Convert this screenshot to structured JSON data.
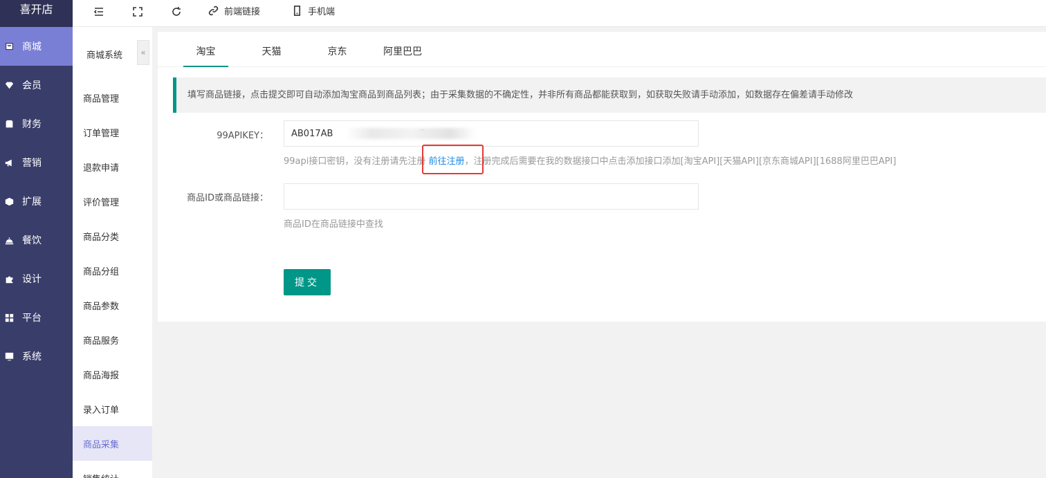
{
  "app": {
    "logo": "喜开店"
  },
  "sidebar": {
    "items": [
      {
        "label": "商城",
        "icon": "shop-icon",
        "active": true
      },
      {
        "label": "会员",
        "icon": "member-icon"
      },
      {
        "label": "财务",
        "icon": "finance-icon"
      },
      {
        "label": "营销",
        "icon": "megaphone-icon"
      },
      {
        "label": "扩展",
        "icon": "cube-icon"
      },
      {
        "label": "餐饮",
        "icon": "dish-icon"
      },
      {
        "label": "设计",
        "icon": "puzzle-icon"
      },
      {
        "label": "平台",
        "icon": "grid-icon"
      },
      {
        "label": "系统",
        "icon": "system-icon"
      }
    ]
  },
  "topbar": {
    "frontend_link": "前端链接",
    "mobile": "手机端"
  },
  "subnav": {
    "title": "商城系统",
    "collapse": "«",
    "items": [
      "商品管理",
      "订单管理",
      "退款申请",
      "评价管理",
      "商品分类",
      "商品分组",
      "商品参数",
      "商品服务",
      "商品海报",
      "录入订单",
      "商品采集",
      "销售统计"
    ],
    "active_index": 10
  },
  "tabs": [
    "淘宝",
    "天猫",
    "京东",
    "阿里巴巴"
  ],
  "notice": "填写商品链接，点击提交即可自动添加淘宝商品到商品列表；由于采集数据的不确定性，并非所有商品都能获取到，如获取失败请手动添加，如数据存在偏差请手动修改",
  "form": {
    "apikey_label": "99APIKEY：",
    "apikey_value": "AB017AB                              C",
    "apikey_help_before": "99api接口密钥，没有注册请先注册",
    "apikey_help_link": "前往注册",
    "apikey_help_after": "，注册完成后需要在我的数据接口中点击添加接口添加[淘宝API][天猫API][京东商城API][1688阿里巴巴API]",
    "goods_label": "商品ID或商品链接：",
    "goods_value": "",
    "goods_help": "商品ID在商品链接中查找",
    "submit": "提交"
  }
}
